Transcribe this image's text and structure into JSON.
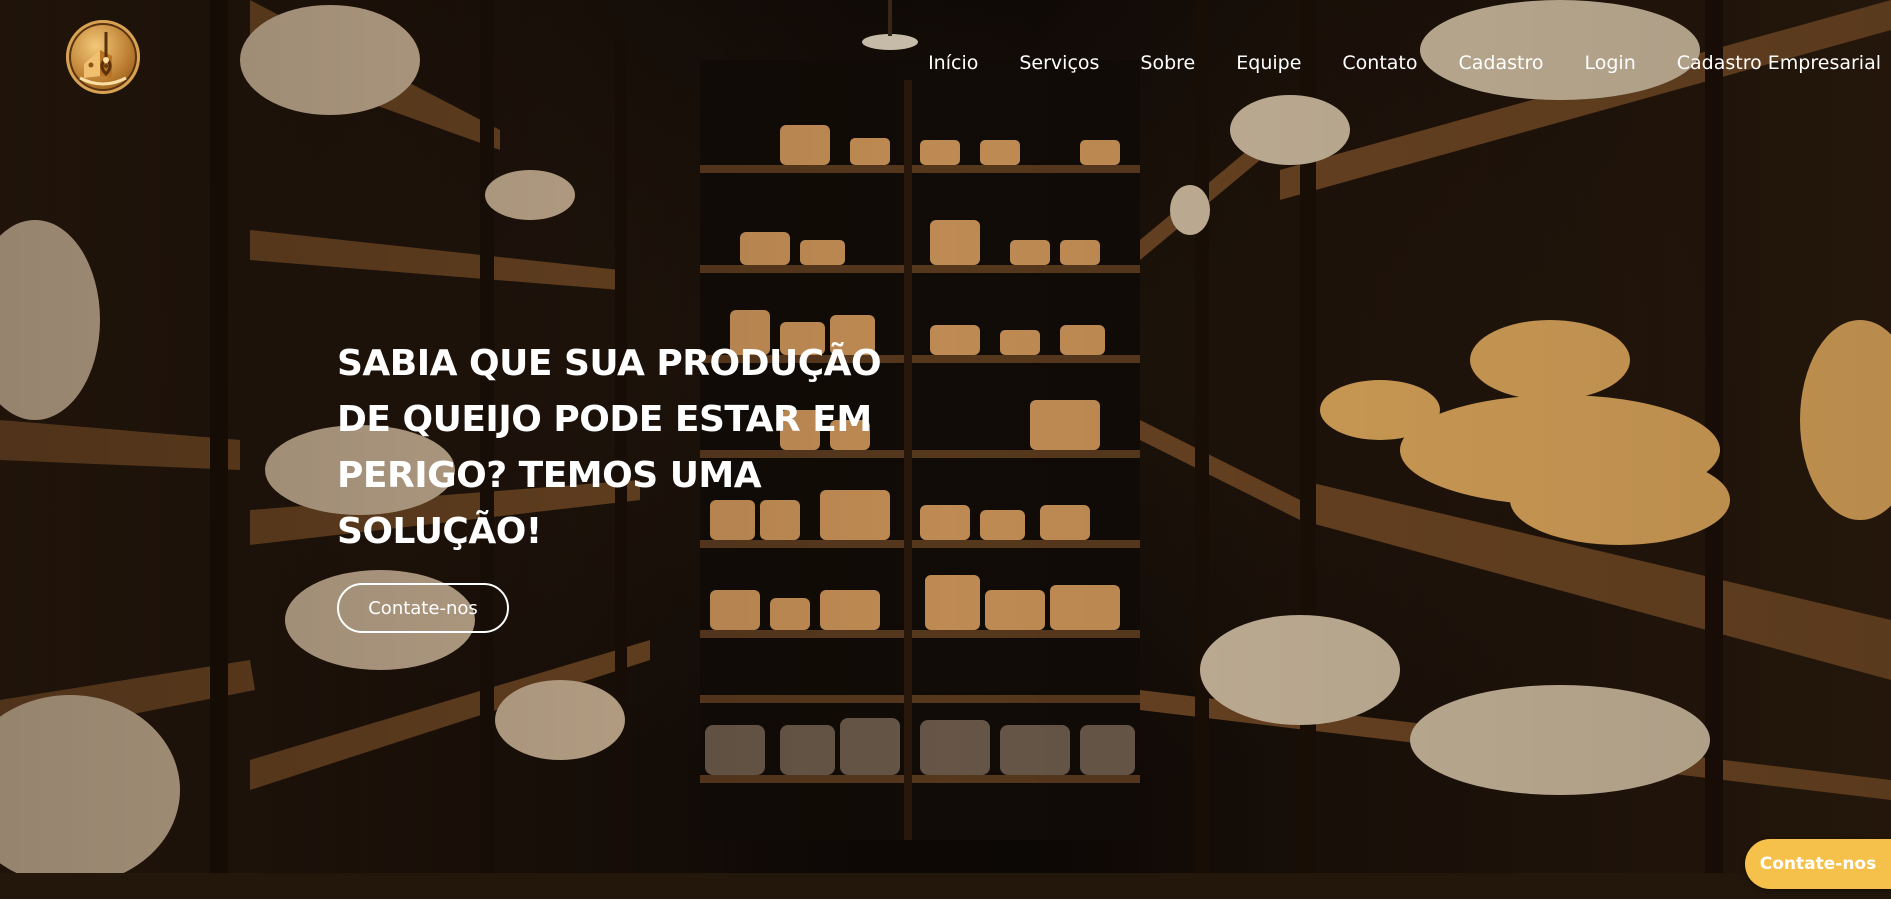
{
  "brand": {
    "logo_icon": "cheese-cellar-logo-icon"
  },
  "nav": {
    "items": [
      {
        "label": "Início"
      },
      {
        "label": "Serviços"
      },
      {
        "label": "Sobre"
      },
      {
        "label": "Equipe"
      },
      {
        "label": "Contato"
      },
      {
        "label": "Cadastro"
      },
      {
        "label": "Login"
      },
      {
        "label": "Cadastro Empresarial"
      }
    ]
  },
  "hero": {
    "headline": "SABIA QUE SUA PRODUÇÃO DE QUEIJO PODE ESTAR EM PERIGO? TEMOS UMA SOLUÇÃO!",
    "cta_label": "Contate-nos",
    "background_image": "cheese-aging-cellar-photo"
  },
  "floating_cta": {
    "label": "Contate-nos"
  },
  "colors": {
    "accent": "#f6c14a",
    "text": "#ffffff",
    "footer_strip": "#23170c"
  }
}
